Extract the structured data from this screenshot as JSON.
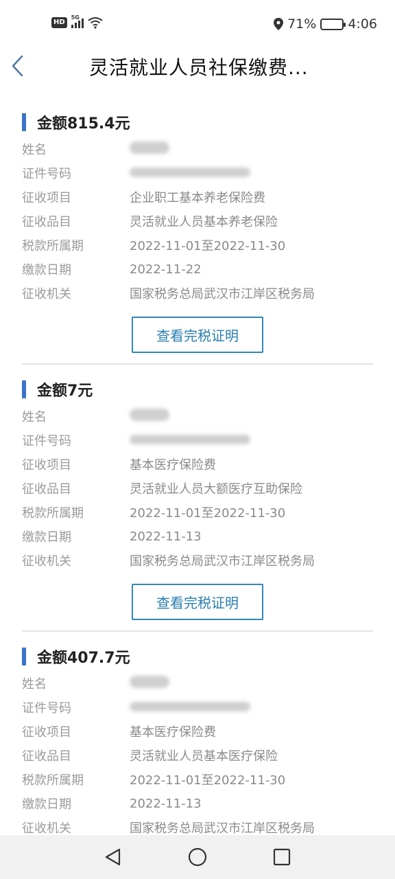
{
  "status_bar": {
    "network_badge": "HD",
    "network_type": "5G",
    "battery_percent": "71%",
    "battery_level": 0.71,
    "time": "4:06",
    "icons": [
      "signal-icon",
      "wifi-icon",
      "location-icon",
      "battery-icon"
    ]
  },
  "header": {
    "title": "灵活就业人员社保缴费..."
  },
  "labels": {
    "name": "姓名",
    "id_number": "证件号码",
    "levy_item": "征收项目",
    "levy_subitem": "征收品目",
    "tax_period": "税款所属期",
    "pay_date": "缴款日期",
    "authority": "征收机关",
    "proof_button": "查看完税证明"
  },
  "records": [
    {
      "amount": "金额815.4元",
      "levy_item": "企业职工基本养老保险费",
      "levy_subitem": "灵活就业人员基本养老保险",
      "tax_period": "2022-11-01至2022-11-30",
      "pay_date": "2022-11-22",
      "authority": "国家税务总局武汉市江岸区税务局"
    },
    {
      "amount": "金额7元",
      "levy_item": "基本医疗保险费",
      "levy_subitem": "灵活就业人员大额医疗互助保险",
      "tax_period": "2022-11-01至2022-11-30",
      "pay_date": "2022-11-13",
      "authority": "国家税务总局武汉市江岸区税务局"
    },
    {
      "amount": "金额407.7元",
      "levy_item": "基本医疗保险费",
      "levy_subitem": "灵活就业人员基本医疗保险",
      "tax_period": "2022-11-01至2022-11-30",
      "pay_date": "2022-11-13",
      "authority": "国家税务总局武汉市江岸区税务局"
    }
  ],
  "colors": {
    "accent_bar": "#3b73c7",
    "button_border": "#2f86b8",
    "label_gray": "#9b9b9b"
  }
}
